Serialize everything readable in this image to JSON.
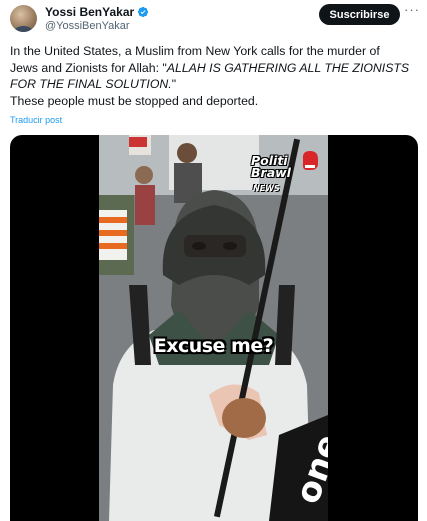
{
  "author": {
    "display_name": "Yossi BenYakar",
    "handle": "@YossiBenYakar",
    "verified": true
  },
  "actions": {
    "subscribe_label": "Suscribirse",
    "more_label": "···"
  },
  "tweet": {
    "line1": "In the United States, a Muslim from New York calls for the murder of Jews and Zionists for Allah: \"",
    "quote": "ALLAH IS GATHERING ALL THE ZIONISTS FOR THE FINAL SOLUTION.",
    "line1_end": "\"",
    "line2": "These people must be stopped and deported.",
    "translate_label": "Traducir post"
  },
  "video": {
    "caption": "Excuse me?",
    "logo_text": "Politi Brawl",
    "logo_sub": "NEWS",
    "signage_text": "one"
  },
  "colors": {
    "accent": "#1d9bf0",
    "text": "#0f1419",
    "secondary": "#536471",
    "button_bg": "#0f1419"
  }
}
